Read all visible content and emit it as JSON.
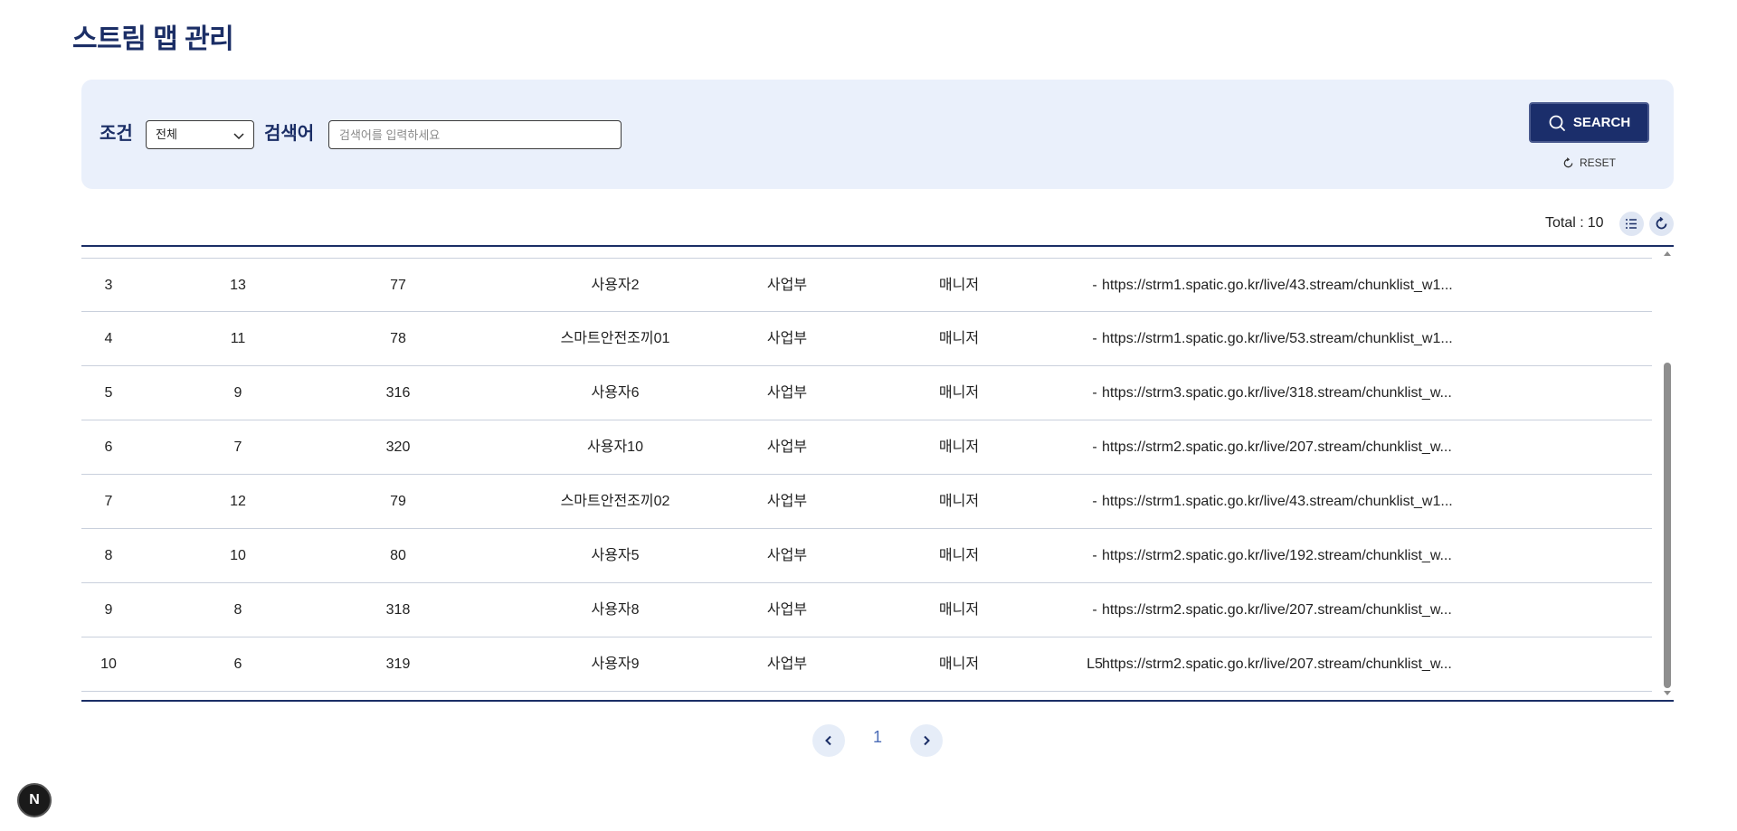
{
  "page": {
    "title": "스트림 맵 관리"
  },
  "search": {
    "condition_label": "조건",
    "condition_value": "전체",
    "keyword_label": "검색어",
    "keyword_placeholder": "검색어를 입력하세요",
    "keyword_value": "",
    "search_label": "SEARCH",
    "reset_label": "RESET"
  },
  "toolbar": {
    "total_label": "Total :",
    "total_count": "10"
  },
  "table": {
    "rows": [
      {
        "no": "3",
        "a": "13",
        "b": "77",
        "user": "사용자2",
        "dept": "사업부",
        "role": "매니저",
        "level": "-",
        "url": "https://strm1.spatic.go.kr/live/43.stream/chunklist_w1..."
      },
      {
        "no": "4",
        "a": "11",
        "b": "78",
        "user": "스마트안전조끼01",
        "dept": "사업부",
        "role": "매니저",
        "level": "-",
        "url": "https://strm1.spatic.go.kr/live/53.stream/chunklist_w1..."
      },
      {
        "no": "5",
        "a": "9",
        "b": "316",
        "user": "사용자6",
        "dept": "사업부",
        "role": "매니저",
        "level": "-",
        "url": "https://strm3.spatic.go.kr/live/318.stream/chunklist_w..."
      },
      {
        "no": "6",
        "a": "7",
        "b": "320",
        "user": "사용자10",
        "dept": "사업부",
        "role": "매니저",
        "level": "-",
        "url": "https://strm2.spatic.go.kr/live/207.stream/chunklist_w..."
      },
      {
        "no": "7",
        "a": "12",
        "b": "79",
        "user": "스마트안전조끼02",
        "dept": "사업부",
        "role": "매니저",
        "level": "-",
        "url": "https://strm1.spatic.go.kr/live/43.stream/chunklist_w1..."
      },
      {
        "no": "8",
        "a": "10",
        "b": "80",
        "user": "사용자5",
        "dept": "사업부",
        "role": "매니저",
        "level": "-",
        "url": "https://strm2.spatic.go.kr/live/192.stream/chunklist_w..."
      },
      {
        "no": "9",
        "a": "8",
        "b": "318",
        "user": "사용자8",
        "dept": "사업부",
        "role": "매니저",
        "level": "-",
        "url": "https://strm2.spatic.go.kr/live/207.stream/chunklist_w..."
      },
      {
        "no": "10",
        "a": "6",
        "b": "319",
        "user": "사용자9",
        "dept": "사업부",
        "role": "매니저",
        "level": "L5",
        "url": "https://strm2.spatic.go.kr/live/207.stream/chunklist_w..."
      }
    ]
  },
  "pagination": {
    "current": "1"
  },
  "fab": {
    "label": "N"
  },
  "icons": {
    "list": "list-icon",
    "refresh": "refresh-icon",
    "search": "search-icon",
    "reset": "reset-icon",
    "prev": "chevron-left-icon",
    "next": "chevron-right-icon",
    "chevron": "chevron-down-icon"
  },
  "colors": {
    "primary": "#1b2e66",
    "panel": "#eaf0fb",
    "page_link": "#4b6cb7"
  }
}
